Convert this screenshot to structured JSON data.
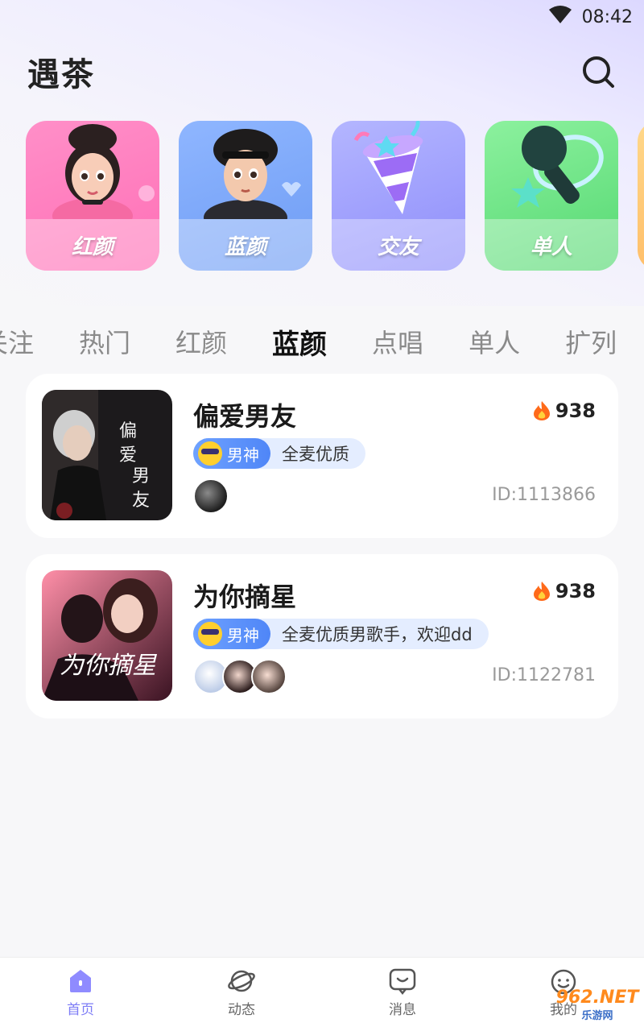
{
  "status_bar": {
    "time": "08:42"
  },
  "header": {
    "title": "遇茶"
  },
  "categories": [
    {
      "label": "红颜"
    },
    {
      "label": "蓝颜"
    },
    {
      "label": "交友"
    },
    {
      "label": "单人"
    }
  ],
  "tabs": [
    "关注",
    "热门",
    "红颜",
    "蓝颜",
    "点唱",
    "单人",
    "扩列"
  ],
  "active_tab": "蓝颜",
  "rooms": [
    {
      "title": "偏爱男友",
      "heat": "938",
      "badge": "男神",
      "desc": "全麦优质",
      "room_id": "ID:1113866",
      "cover_text": "偏爱男友"
    },
    {
      "title": "为你摘星",
      "heat": "938",
      "badge": "男神",
      "desc": "全麦优质男歌手，欢迎dd",
      "room_id": "ID:1122781",
      "cover_text": "为你摘星"
    }
  ],
  "bottom_nav": [
    {
      "label": "首页"
    },
    {
      "label": "动态"
    },
    {
      "label": "消息"
    },
    {
      "label": "我的"
    }
  ],
  "watermark": {
    "line1": "962.NET",
    "line2": "乐游网"
  },
  "colors": {
    "accent": "#7d7cf6",
    "badge_blue": "#4f86f7",
    "tag_bg": "#e4edff"
  }
}
